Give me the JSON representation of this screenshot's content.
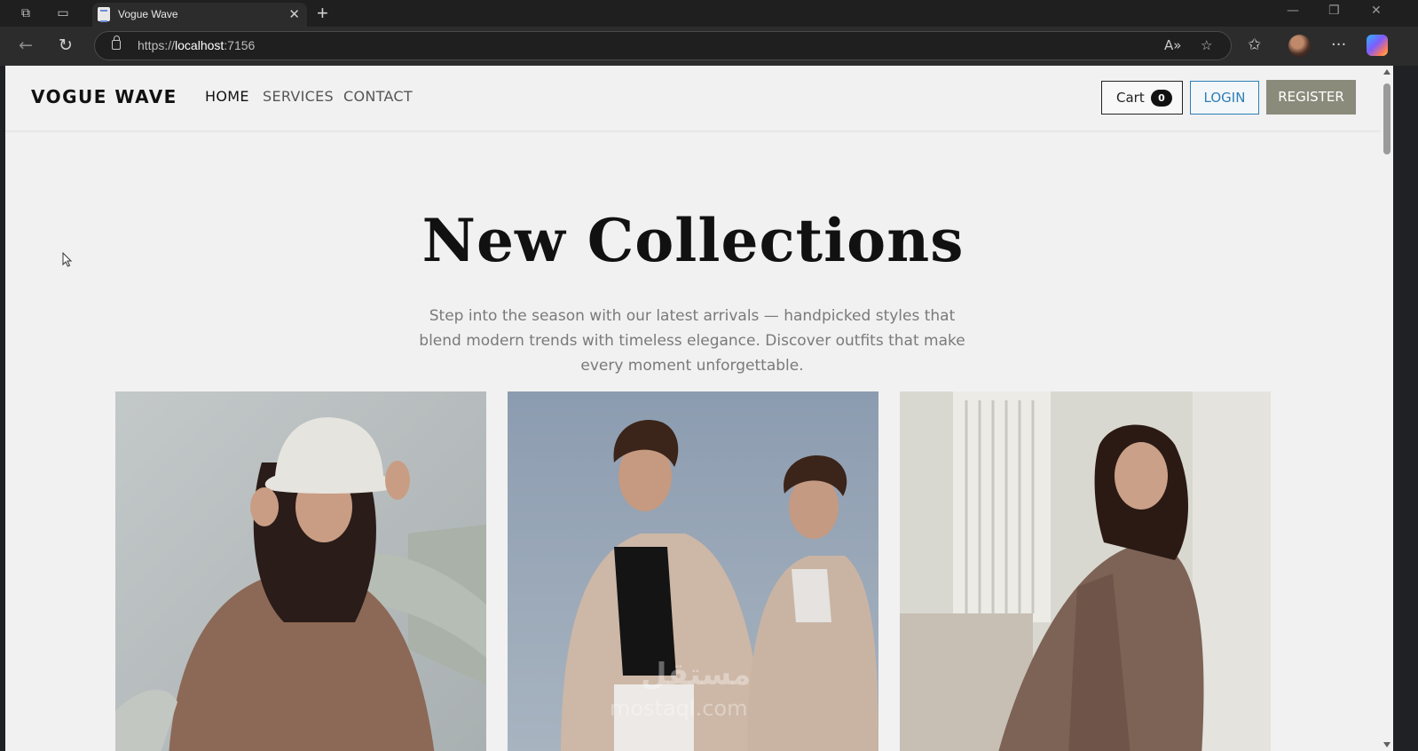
{
  "browser": {
    "tab_title": "Vogue Wave",
    "url_scheme": "https://",
    "url_host": "localhost",
    "url_port": ":7156"
  },
  "site": {
    "brand": "VOGUE WAVE",
    "nav": [
      {
        "label": "HOME",
        "active": true
      },
      {
        "label": "SERVICES",
        "active": false
      },
      {
        "label": "CONTACT",
        "active": false
      }
    ],
    "cart_label": "Cart",
    "cart_count": "0",
    "login_label": "LOGIN",
    "register_label": "REGISTER"
  },
  "hero": {
    "title": "New Collections",
    "subtitle": "Step into the season with our latest arrivals — handpicked styles that blend modern trends with timeless elegance. Discover outfits that make every moment unforgettable."
  },
  "colors": {
    "page_bg": "#f1f1f1",
    "accent_login": "#2f7fb5",
    "register_bg": "#8b8b7c"
  },
  "icons": [
    "tab-actions-icon",
    "vertical-tabs-icon",
    "page-favicon",
    "close-icon",
    "plus-icon",
    "back-icon",
    "refresh-icon",
    "lock-icon",
    "read-aloud-icon",
    "favorite-star-icon",
    "favorites-icon",
    "profile-avatar",
    "more-icon",
    "copilot-icon"
  ]
}
